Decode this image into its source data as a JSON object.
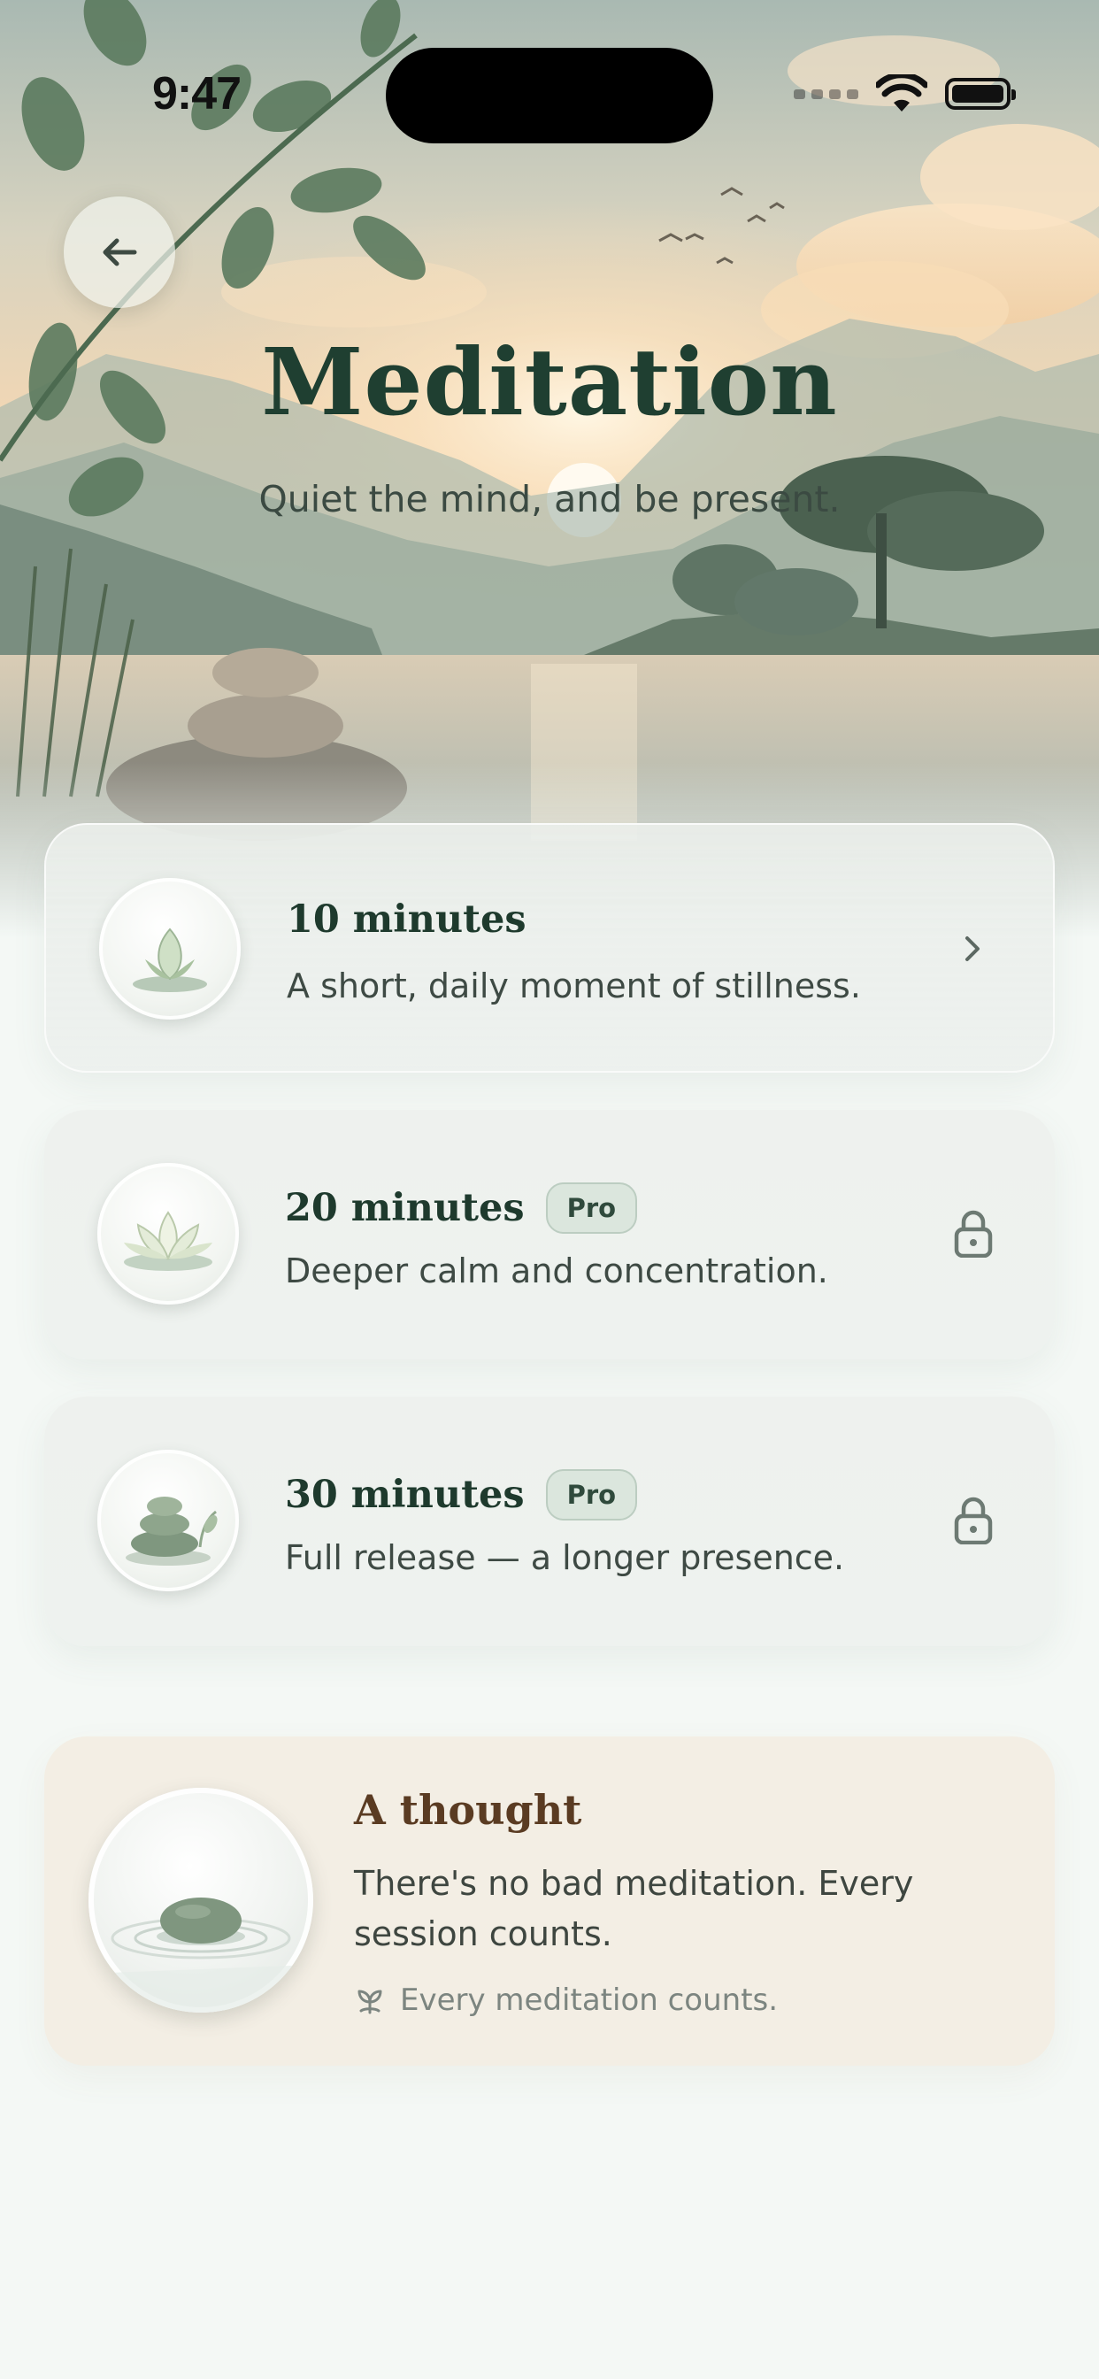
{
  "status_bar": {
    "time": "9:47"
  },
  "header": {
    "back_icon": "arrow-left-icon",
    "title": "Meditation",
    "subtitle": "Quiet the mind, and be present."
  },
  "sessions": [
    {
      "title": "10 minutes",
      "description": "A short, daily moment of stillness.",
      "icon": "lotus-bud-icon",
      "trailing_icon": "chevron-right-icon",
      "locked": false
    },
    {
      "title": "20 minutes",
      "badge": "Pro",
      "description": "Deeper calm and concentration.",
      "icon": "lotus-flower-icon",
      "trailing_icon": "lock-icon",
      "locked": true
    },
    {
      "title": "30 minutes",
      "badge": "Pro",
      "description": "Full release — a longer presence.",
      "icon": "stacked-stones-icon",
      "trailing_icon": "lock-icon",
      "locked": true
    }
  ],
  "thought": {
    "title": "A thought",
    "body": "There's no bad meditation. Every session counts.",
    "footer_icon": "sprout-icon",
    "footer": "Every meditation counts."
  },
  "colors": {
    "title_green": "#1f3f31",
    "card_bg": "#eef1ee",
    "thought_bg": "#f3eee4",
    "thought_title": "#5a3b22",
    "badge_bg": "#dbe6dd",
    "page_bg": "#f4f8f5"
  }
}
